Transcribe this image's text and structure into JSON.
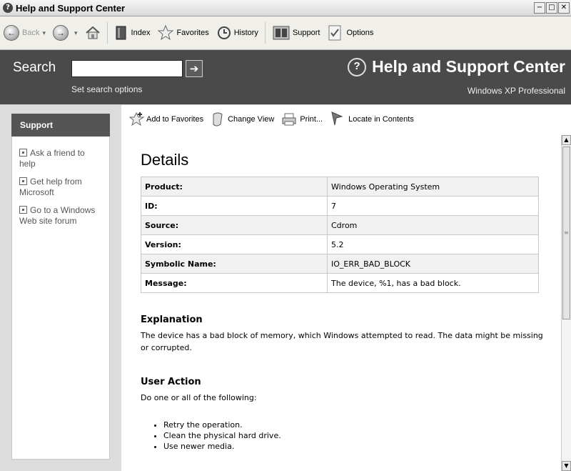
{
  "window": {
    "title": "Help and Support Center",
    "controls": [
      "−",
      "□",
      "✕"
    ]
  },
  "toolbar": {
    "back_label": "Back",
    "index_label": "Index",
    "favorites_label": "Favorites",
    "history_label": "History",
    "support_label": "Support",
    "options_label": "Options"
  },
  "header": {
    "search_label": "Search",
    "search_value": "",
    "search_options": "Set search options",
    "brand_title": "Help and Support Center",
    "edition": "Windows XP Professional"
  },
  "sidebar": {
    "heading": "Support",
    "links": [
      "Ask a friend to help",
      "Get help from Microsoft",
      "Go to a Windows Web site forum"
    ]
  },
  "content_toolbar": {
    "add_favorites": "Add to Favorites",
    "change_view": "Change View",
    "print": "Print...",
    "locate": "Locate in Contents"
  },
  "details": {
    "title": "Details",
    "rows": [
      {
        "key": "Product:",
        "value": "Windows Operating System"
      },
      {
        "key": "ID:",
        "value": "7"
      },
      {
        "key": "Source:",
        "value": "Cdrom"
      },
      {
        "key": "Version:",
        "value": "5.2"
      },
      {
        "key": "Symbolic Name:",
        "value": "IO_ERR_BAD_BLOCK"
      },
      {
        "key": "Message:",
        "value": "The device, %1, has a bad block."
      }
    ]
  },
  "explanation": {
    "title": "Explanation",
    "text": "The device has a bad block of memory, which Windows attempted to read. The data might be missing or corrupted."
  },
  "user_action": {
    "title": "User Action",
    "intro": "Do one or all of the following:",
    "items": [
      "Retry the operation.",
      "Clean the physical hard drive.",
      "Use newer media."
    ]
  },
  "icons": {
    "app": "help-circle-icon",
    "back": "back-arrow-icon",
    "forward": "forward-arrow-icon",
    "home": "home-icon",
    "index": "book-icon",
    "favorites": "star-icon",
    "history": "clock-icon",
    "support": "support-icon",
    "options": "checklist-icon",
    "go": "arrow-right-icon",
    "add_favorites": "star-plus-icon",
    "change_view": "change-view-icon",
    "print": "printer-icon",
    "locate": "locate-icon"
  }
}
